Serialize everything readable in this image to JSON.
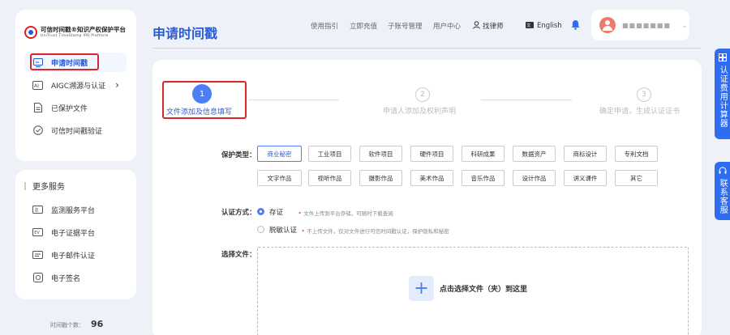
{
  "brand": {
    "title": "可信时间戳®知识产权保护平台",
    "subtitle": "UniTrust TimeStamp IPR Platform"
  },
  "sidebar": {
    "items": [
      {
        "label": "申请时间戳",
        "icon": "screen-icon"
      },
      {
        "label": "AIGC溯源与认证",
        "icon": "aigc-icon",
        "chevron": "›"
      },
      {
        "label": "已保护文件",
        "icon": "document-icon"
      },
      {
        "label": "可信时间戳验证",
        "icon": "check-circle-icon"
      }
    ],
    "more_title": "更多服务",
    "more_items": [
      {
        "label": "监测服务平台",
        "icon": "monitor-icon"
      },
      {
        "label": "电子证据平台",
        "icon": "ev-icon"
      },
      {
        "label": "电子邮件认证",
        "icon": "mail-icon"
      },
      {
        "label": "电子签名",
        "icon": "signature-icon"
      }
    ],
    "count_label": "时间戳个数：",
    "count_value": "96"
  },
  "header": {
    "page_title": "申请时间戳",
    "nav": [
      "使用指引",
      "立即充值",
      "子账号管理",
      "用户中心"
    ],
    "lawyer_label": "找律师",
    "language_label": "English",
    "user_name": "■■■■■■■",
    "user_chevron": "⌄"
  },
  "steps": [
    {
      "number": "1",
      "label": "文件添加及信息填写",
      "state": "active"
    },
    {
      "number": "2",
      "label": "申请人添加及权利声明",
      "state": "inactive"
    },
    {
      "number": "3",
      "label": "确定申请，生成认证证书",
      "state": "inactive"
    }
  ],
  "form": {
    "protect_type_label": "保护类型：",
    "protect_types_row1": [
      "商业秘密",
      "工业项目",
      "软件项目",
      "硬件项目",
      "科研成果",
      "数据资产",
      "商标设计",
      "专利文档"
    ],
    "protect_types_row2": [
      "文字作品",
      "视听作品",
      "摄影作品",
      "美术作品",
      "音乐作品",
      "设计作品",
      "讲义课件",
      "其它"
    ],
    "selected_type": "商业秘密",
    "auth_method_label": "认证方式：",
    "auth_options": [
      {
        "label": "存证",
        "hint": "文件上传到平台存储，可随时下载查阅",
        "selected": true
      },
      {
        "label": "脱敏认证",
        "hint": "不上传文件，仅对文件进行可信时间戳认证，保护隐私和秘密",
        "selected": false
      }
    ],
    "required_mark": "*",
    "file_label": "选择文件：",
    "drop_text": "点击选择文件（夹）到这里",
    "plus_symbol": "+"
  },
  "float_buttons": [
    {
      "label": "认证费用计算器",
      "icon": "calculator-icon"
    },
    {
      "label": "联系客服",
      "icon": "headset-icon"
    }
  ],
  "colors": {
    "accent": "#2a5bd7",
    "step_active": "#4d7ef7",
    "highlight_border": "#d8262b",
    "float_button": "#2f6df0"
  }
}
